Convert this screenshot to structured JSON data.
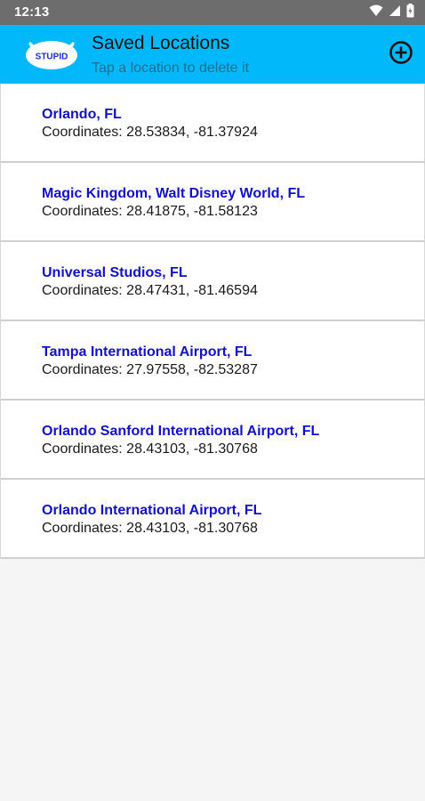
{
  "status_bar": {
    "time": "12:13",
    "icons": [
      "wifi-icon",
      "cell-signal-icon",
      "battery-icon"
    ]
  },
  "app_bar": {
    "logo_text": "STUPID",
    "title": "Saved Locations",
    "subtitle": "Tap a location to delete it",
    "add_icon": "add-circle-icon",
    "background_color": "#00b8fa"
  },
  "locations": {
    "coordinates_prefix": "Coordinates:",
    "items": [
      {
        "name": "Orlando, FL",
        "coords": "28.53834, -81.37924"
      },
      {
        "name": "Magic Kingdom, Walt Disney World, FL",
        "coords": "28.41875, -81.58123"
      },
      {
        "name": "Universal Studios, FL",
        "coords": "28.47431, -81.46594"
      },
      {
        "name": "Tampa International Airport, FL",
        "coords": "27.97558, -82.53287"
      },
      {
        "name": "Orlando Sanford International Airport, FL",
        "coords": "28.43103, -81.30768"
      },
      {
        "name": "Orlando International Airport, FL",
        "coords": "28.43103, -81.30768"
      }
    ]
  },
  "colors": {
    "location_name": "#1111cc",
    "status_bar": "#6d6d6d",
    "page_background": "#f5f5f5"
  }
}
